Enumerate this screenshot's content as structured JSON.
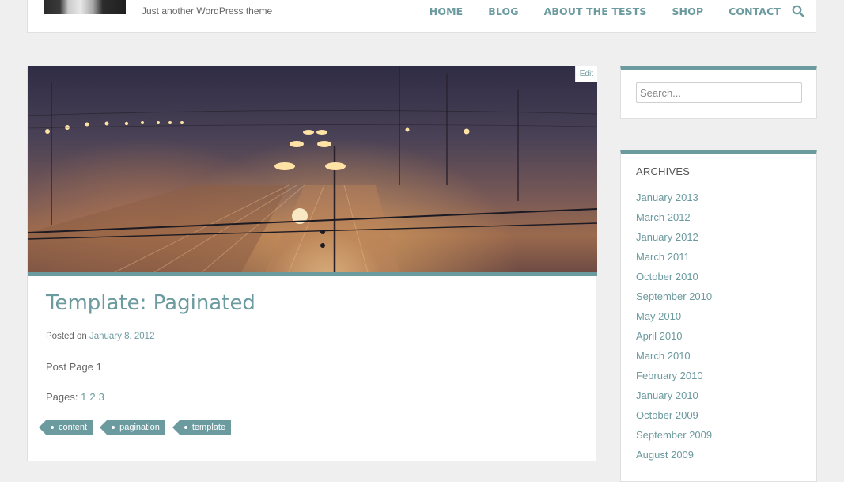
{
  "header": {
    "tagline": "Just another WordPress theme",
    "nav": [
      "HOME",
      "BLOG",
      "ABOUT THE TESTS",
      "SHOP",
      "CONTACT"
    ],
    "search_icon": "search-icon"
  },
  "post": {
    "edit_label": "Edit",
    "title": "Template: Paginated",
    "posted_prefix": "Posted on",
    "posted_date": "January 8, 2012",
    "body": "Post Page 1",
    "pages_label": "Pages:",
    "pages": [
      "1",
      "2",
      "3"
    ],
    "tags": [
      "content",
      "pagination",
      "template"
    ]
  },
  "sidebar": {
    "search": {
      "placeholder": "Search..."
    },
    "archives": {
      "title": "ARCHIVES",
      "items": [
        "January 2013",
        "March 2012",
        "January 2012",
        "March 2011",
        "October 2010",
        "September 2010",
        "May 2010",
        "April 2010",
        "March 2010",
        "February 2010",
        "January 2010",
        "October 2009",
        "September 2009",
        "August 2009"
      ]
    }
  },
  "colors": {
    "accent": "#6b9a9f",
    "background": "#efefef"
  }
}
